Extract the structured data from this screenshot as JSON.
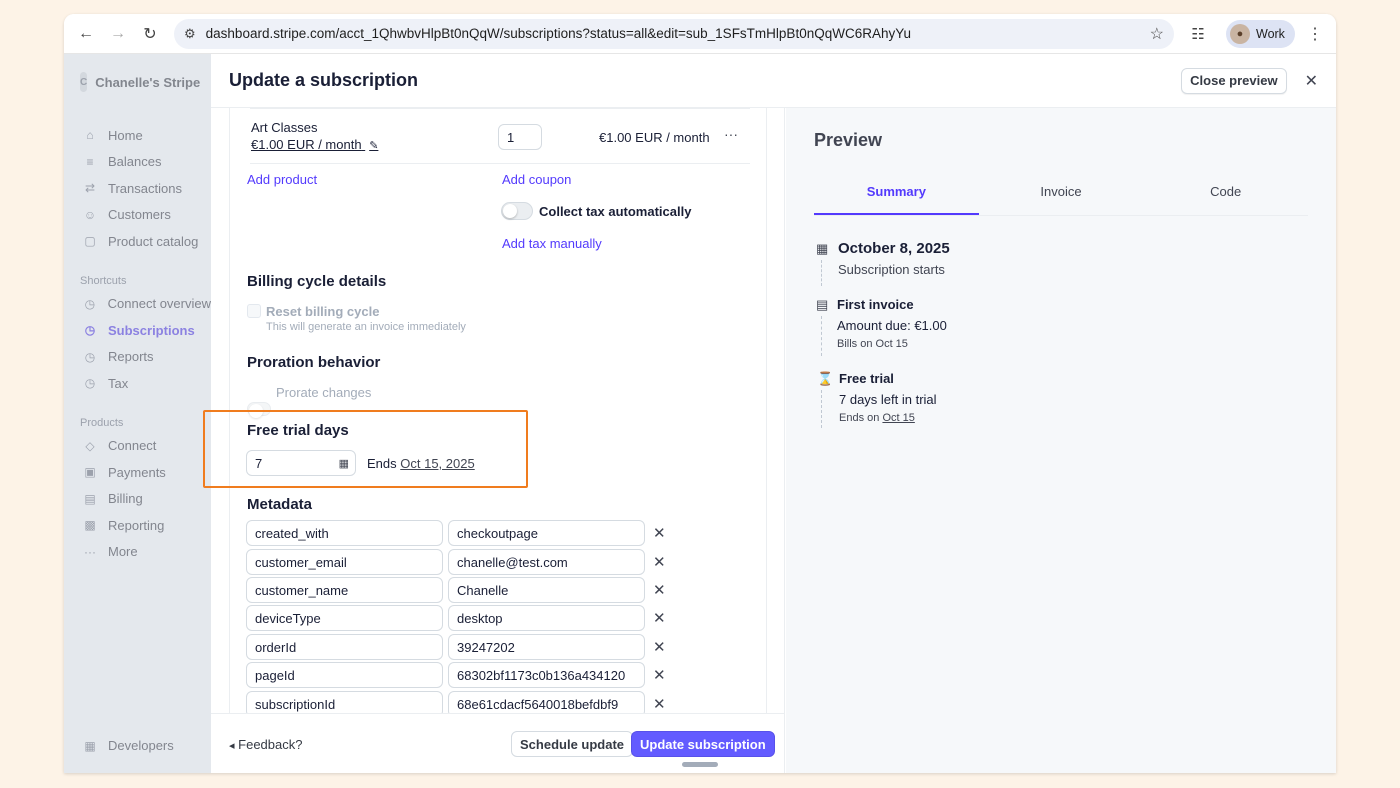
{
  "browser": {
    "url": "dashboard.stripe.com/acct_1QhwbvHlpBt0nQqW/subscriptions?status=all&edit=sub_1SFsTmHlpBt0nQqWC6RAhyYu",
    "profile_label": "Work"
  },
  "sidebar": {
    "account_initial": "C",
    "account_name": "Chanelle's Stripe",
    "main_items": [
      {
        "label": "Home",
        "icon": "home-icon"
      },
      {
        "label": "Balances",
        "icon": "balances-icon"
      },
      {
        "label": "Transactions",
        "icon": "transactions-icon"
      },
      {
        "label": "Customers",
        "icon": "customers-icon"
      },
      {
        "label": "Product catalog",
        "icon": "box-icon"
      }
    ],
    "shortcuts_heading": "Shortcuts",
    "shortcuts": [
      {
        "label": "Connect overview"
      },
      {
        "label": "Subscriptions",
        "active": true
      },
      {
        "label": "Reports"
      },
      {
        "label": "Tax"
      }
    ],
    "products_heading": "Products",
    "products": [
      {
        "label": "Connect"
      },
      {
        "label": "Payments"
      },
      {
        "label": "Billing"
      },
      {
        "label": "Reporting"
      },
      {
        "label": "More"
      }
    ],
    "developers_label": "Developers"
  },
  "drawer": {
    "title": "Update a subscription",
    "close_preview_label": "Close preview"
  },
  "form": {
    "product_name": "Art Classes",
    "product_price": "€1.00 EUR / month",
    "quantity": "1",
    "line_total": "€1.00 EUR / month",
    "add_product": "Add product",
    "add_coupon": "Add coupon",
    "collect_tax": "Collect tax automatically",
    "add_tax_manually": "Add tax manually",
    "billing_cycle_title": "Billing cycle details",
    "reset_billing_cycle": "Reset billing cycle",
    "reset_billing_hint": "This will generate an invoice immediately",
    "proration_title": "Proration behavior",
    "prorate_changes": "Prorate changes",
    "free_trial_title": "Free trial days",
    "free_trial_value": "7",
    "ends_prefix": "Ends",
    "ends_date": "Oct 15, 2025",
    "metadata_title": "Metadata",
    "metadata": [
      {
        "key": "created_with",
        "value": "checkoutpage"
      },
      {
        "key": "customer_email",
        "value": "chanelle@test.com"
      },
      {
        "key": "customer_name",
        "value": "Chanelle"
      },
      {
        "key": "deviceType",
        "value": "desktop"
      },
      {
        "key": "orderId",
        "value": "39247202"
      },
      {
        "key": "pageId",
        "value": "68302bf1173c0b136a434120"
      },
      {
        "key": "subscriptionId",
        "value": "68e61cdacf5640018befdbf9"
      }
    ]
  },
  "footer": {
    "feedback": "Feedback?",
    "schedule_update": "Schedule update",
    "update_subscription": "Update subscription"
  },
  "preview": {
    "title": "Preview",
    "tabs": [
      "Summary",
      "Invoice",
      "Code"
    ],
    "start_date": "October 8, 2025",
    "start_caption": "Subscription starts",
    "first_invoice_title": "First invoice",
    "amount_due": "Amount due: €1.00",
    "bills_on": "Bills on Oct 15",
    "free_trial_title": "Free trial",
    "days_left": "7 days left in trial",
    "ends_on_prefix": "Ends on",
    "ends_on_date": "Oct 15"
  }
}
